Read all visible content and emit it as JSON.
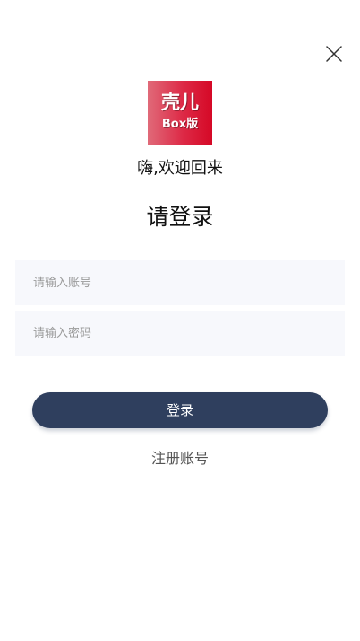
{
  "header": {
    "close_icon": "close-icon"
  },
  "logo": {
    "line1": "壳儿",
    "line2": "Box版"
  },
  "welcome_text": "嗨,欢迎回来",
  "title": "请登录",
  "form": {
    "account_placeholder": "请输入账号",
    "account_value": "",
    "password_placeholder": "请输入密码",
    "password_value": ""
  },
  "actions": {
    "login_label": "登录",
    "register_label": "注册账号"
  },
  "colors": {
    "primary_button": "#2f3f5e",
    "input_background": "#f7f8fc",
    "logo_red": "#d50826"
  }
}
